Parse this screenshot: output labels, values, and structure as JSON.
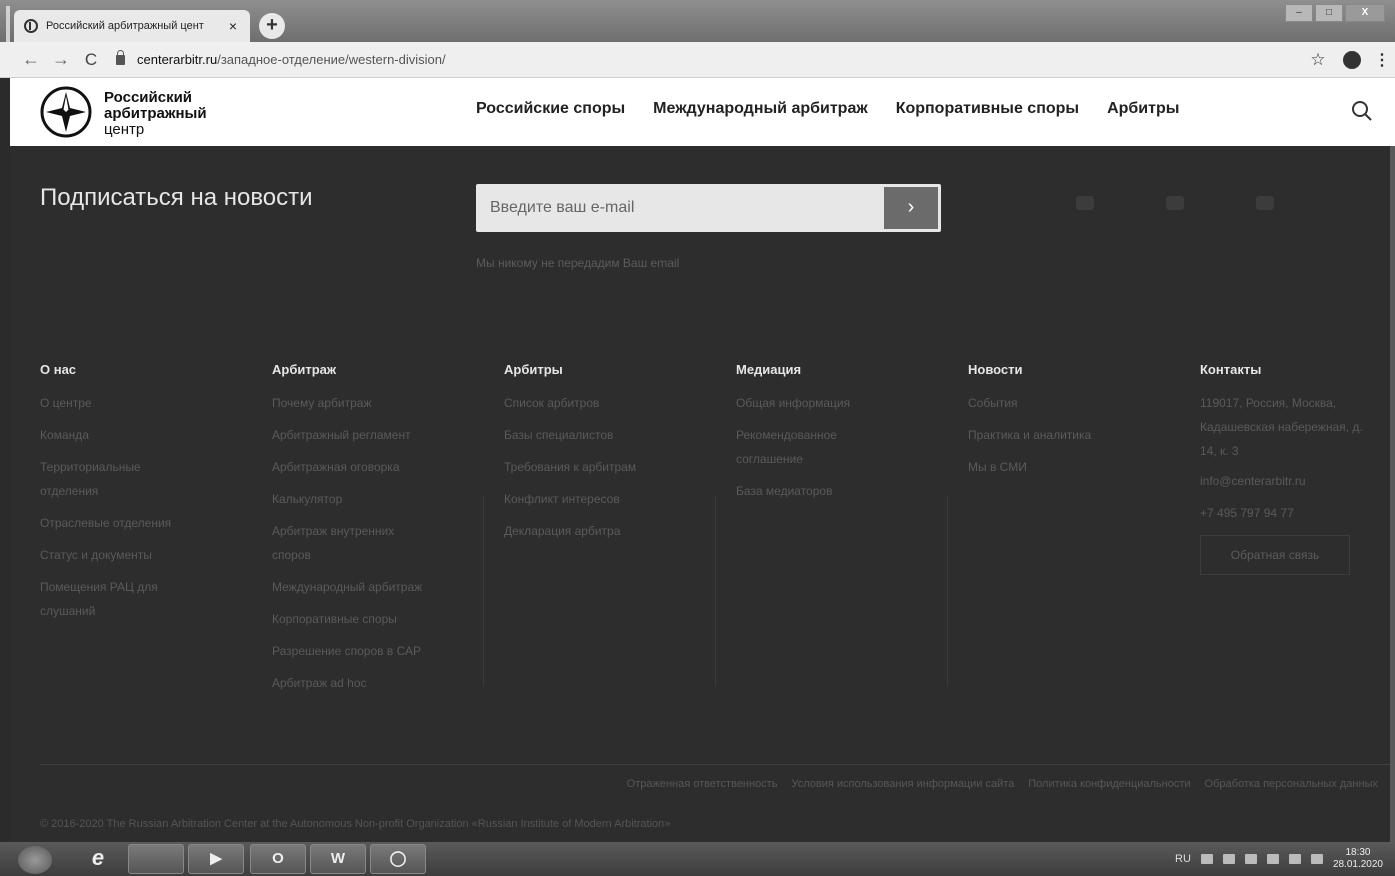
{
  "browser": {
    "tab_title": "Российский арбитражный цент",
    "tab_close": "×",
    "new_tab": "+",
    "url_domain": "centerarbitr.ru",
    "url_path": "/западное-отделение/western-division/",
    "star_icon": "☆",
    "menu_icon": "⋮",
    "back_icon": "←",
    "forward_icon": "→",
    "reload_icon": "C",
    "window_minimize": "–",
    "window_maximize": "□",
    "window_close": "X"
  },
  "header": {
    "logo_line1": "Российский",
    "logo_line2": "арбитражный",
    "logo_line3": "центр",
    "nav": [
      "Российские споры",
      "Международный арбитраж",
      "Корпоративные споры",
      "Арбитры"
    ]
  },
  "subscribe": {
    "title": "Подписаться на новости",
    "placeholder": "Введите ваш e-mail",
    "submit_icon": "›",
    "note": "Мы никому не передадим Ваш email"
  },
  "footer_columns": [
    {
      "title": "О нас",
      "links": [
        "О центре",
        "Команда",
        "Территориальные отделения",
        "Отраслевые отделения",
        "Статус и документы",
        "Помещения РАЦ для слушаний"
      ]
    },
    {
      "title": "Арбитраж",
      "links": [
        "Почему арбитраж",
        "Арбитражный регламент",
        "Арбитражная оговорка",
        "Калькулятор",
        "Арбитраж внутренних споров",
        "Международный арбитраж",
        "Корпоративные споры",
        "Разрешение споров в САР",
        "Арбитраж ad hoc"
      ]
    },
    {
      "title": "Арбитры",
      "links": [
        "Список арбитров",
        "Базы специалистов",
        "Требования к арбитрам",
        "Конфликт интересов",
        "Декларация арбитра"
      ]
    },
    {
      "title": "Медиация",
      "links": [
        "Общая информация",
        "Рекомендованное соглашение",
        "База медиаторов"
      ]
    },
    {
      "title": "Новости",
      "links": [
        "События",
        "Практика и аналитика",
        "Мы в СМИ"
      ]
    },
    {
      "title": "Контакты",
      "links": [
        "119017, Россия, Москва, Кадашевская набережная, д. 14, к. 3",
        "info@centerarbitr.ru",
        "+7 495 797 94 77"
      ],
      "button": "Обратная связь"
    }
  ],
  "legal_links": [
    "Отраженная ответственность",
    "Условия использования информации сайта",
    "Политика конфиденциальности",
    "Обработка персональных данных"
  ],
  "copyright": "© 2016-2020 The Russian Arbitration Center at the Autonomous Non-profit Organization «Russian Institute of Modern Arbitration»",
  "taskbar": {
    "apps": [
      "e",
      "",
      "▶",
      "O",
      "W",
      "◯"
    ],
    "lang": "RU",
    "time": "18:30",
    "date": "28.01.2020"
  }
}
